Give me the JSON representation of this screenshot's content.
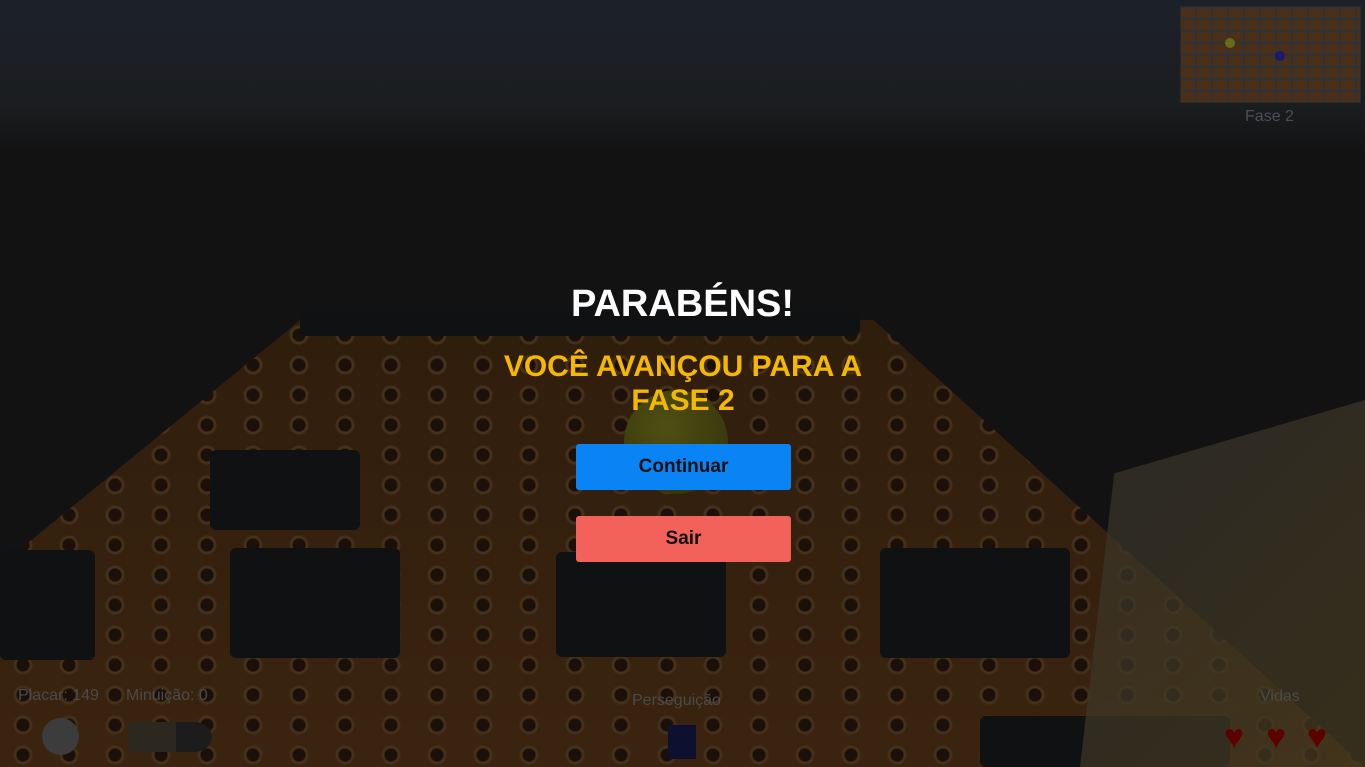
{
  "overlay": {
    "title": "PARABÉNS!",
    "subtitle": "VOCÊ AVANÇOU PARA A FASE 2",
    "continue_label": "Continuar",
    "exit_label": "Sair"
  },
  "minimap": {
    "phase_label": "Fase 2",
    "player_color": "#8a8a20",
    "enemy_color": "#1a1a80"
  },
  "hud": {
    "score_label": "Placar: 149",
    "ammo_label": "Minuição: 0",
    "chase_label": "Perseguição",
    "lives_label": "Vidas",
    "lives": 3,
    "heart_glyph": "♥"
  },
  "colors": {
    "continue": "#0a84f5",
    "exit": "#f2625a",
    "subtitle": "#f5b800"
  }
}
